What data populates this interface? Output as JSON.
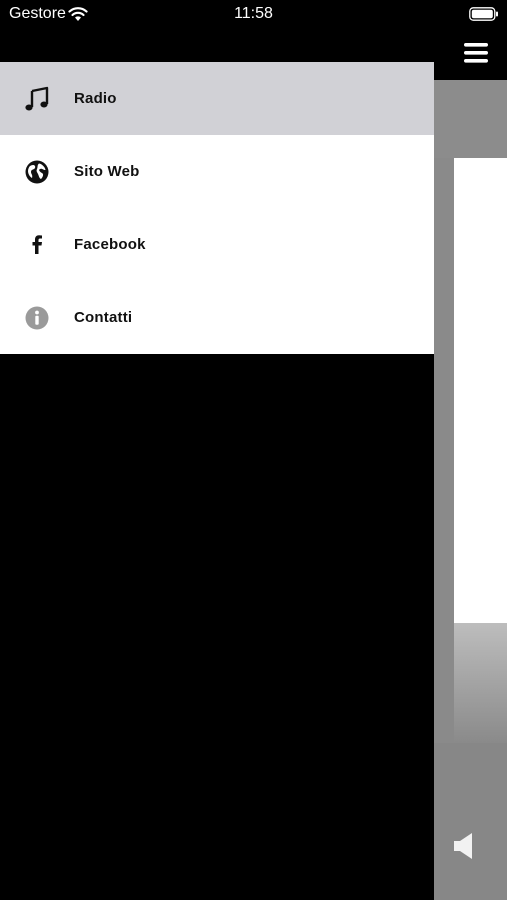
{
  "status_bar": {
    "carrier": "Gestore",
    "time": "11:58",
    "icons": [
      "wifi-icon",
      "battery-icon"
    ]
  },
  "drawer": {
    "items": [
      {
        "label": "Radio",
        "icon": "music-note-icon",
        "active": true
      },
      {
        "label": "Sito Web",
        "icon": "globe-icon",
        "active": false
      },
      {
        "label": "Facebook",
        "icon": "facebook-icon",
        "active": false
      },
      {
        "label": "Contatti",
        "icon": "info-icon",
        "active": false
      }
    ]
  },
  "main": {
    "header_icon": "hamburger-menu-icon",
    "player_icon": "speaker-icon"
  },
  "colors": {
    "active_item_bg": "#d1d1d6",
    "drawer_bg": "#ffffff",
    "background": "#000000",
    "icon_gray": "#9a9a9a"
  }
}
